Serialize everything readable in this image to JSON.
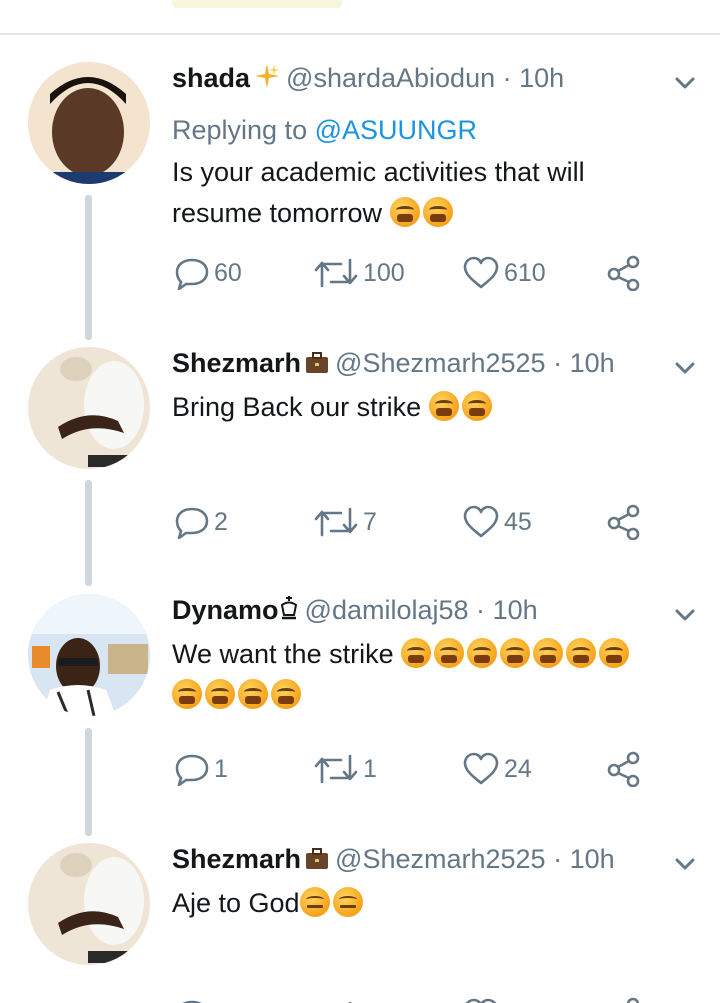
{
  "tweets": [
    {
      "name": "shada",
      "badge": "sparkle-emoji",
      "handle": "@shardaAbiodun",
      "sep": "·",
      "time": "10h",
      "reply_prefix": "Replying to",
      "reply_handle": "@ASUUNGR",
      "text_line1": "Is your academic activities that will",
      "text_line2": "resume tomorrow",
      "emojis": 2,
      "replies": "60",
      "retweets": "100",
      "likes": "610"
    },
    {
      "name": "Shezmarh",
      "badge": "briefcase-emoji",
      "handle": "@Shezmarh2525",
      "sep": "·",
      "time": "10h",
      "text_line1": "Bring Back our strike",
      "emojis": 2,
      "replies": "2",
      "retweets": "7",
      "likes": "45"
    },
    {
      "name": "Dynamo",
      "badge": "crown-symbol",
      "handle": "@damilolaj58",
      "sep": "·",
      "time": "10h",
      "text_line1": "We want the strike",
      "emojis_line1": 7,
      "emojis_line2": 4,
      "replies": "1",
      "retweets": "1",
      "likes": "24"
    },
    {
      "name": "Shezmarh",
      "badge": "briefcase-emoji",
      "handle": "@Shezmarh2525",
      "sep": "·",
      "time": "10h",
      "text_line1": "Aje to God",
      "emojis": 2
    }
  ],
  "colors": {
    "link": "#1b95e0",
    "secondary_text": "#657786",
    "thread_line": "#cfd6dc",
    "emoji": "#f6a21a"
  }
}
